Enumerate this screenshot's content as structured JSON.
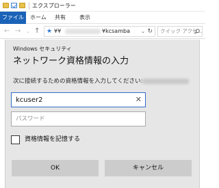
{
  "explorer": {
    "title": "エクスプローラー",
    "ribbon_tabs": [
      "ファイル",
      "ホーム",
      "共有",
      "表示"
    ],
    "address": {
      "prefix": "¥¥",
      "suffix": "¥kcsamba"
    },
    "search_placeholder": "クイック アクセ..."
  },
  "dialog": {
    "caption": "Windows セキュリティ",
    "heading": "ネットワーク資格情報の入力",
    "instruction": "次に接続するための資格情報を入力してください:",
    "username_value": "kcuser2",
    "password_placeholder": "パスワード",
    "remember_label": "資格情報を記憶する",
    "remember_checked": false,
    "ok_label": "OK",
    "cancel_label": "キャンセル"
  },
  "colors": {
    "file_tab": "#1a63b8",
    "focus_border": "#2f6fca",
    "dialog_bg": "#e6e6e6",
    "button_bg": "#cccccc"
  }
}
